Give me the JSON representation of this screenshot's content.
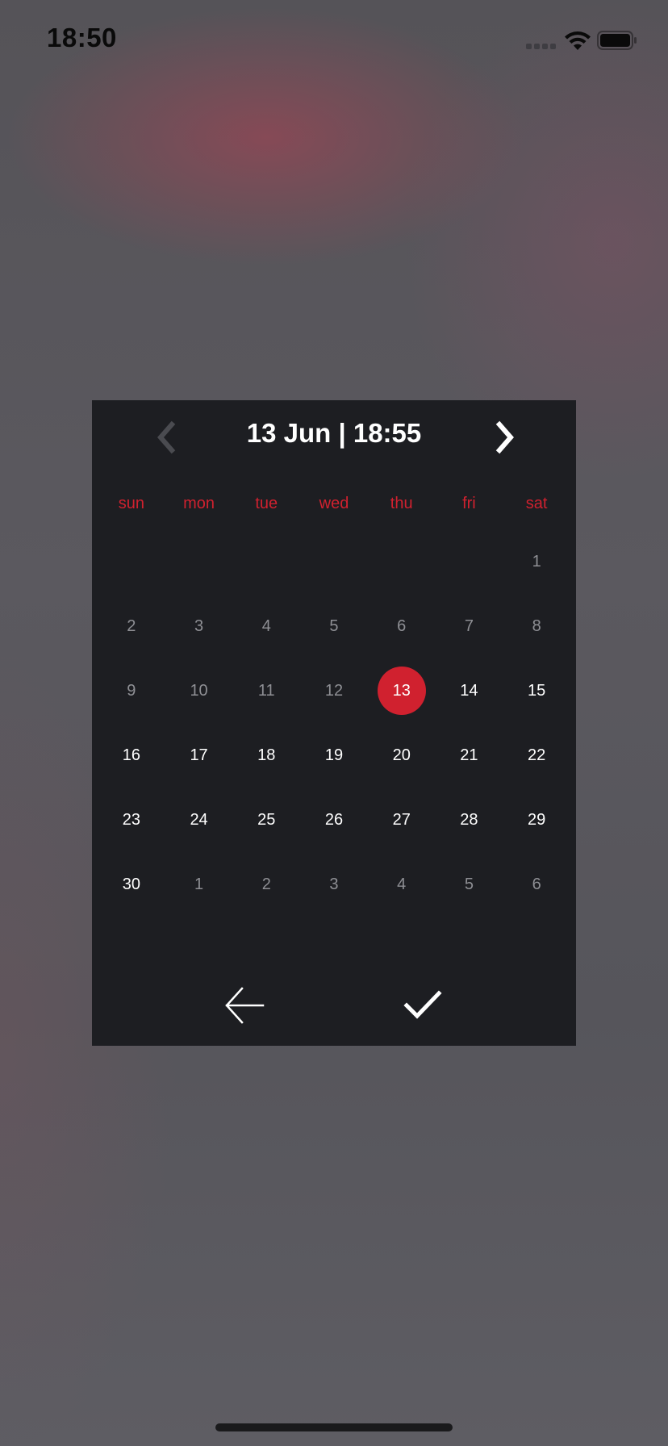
{
  "status_bar": {
    "time": "18:50"
  },
  "calendar": {
    "header_title": "13 Jun | 18:55",
    "weekdays": [
      "sun",
      "mon",
      "tue",
      "wed",
      "thu",
      "fri",
      "sat"
    ],
    "accent_color": "#d0212f",
    "selected_day": "13",
    "weeks": [
      [
        {
          "label": "",
          "state": "empty"
        },
        {
          "label": "",
          "state": "empty"
        },
        {
          "label": "",
          "state": "empty"
        },
        {
          "label": "",
          "state": "empty"
        },
        {
          "label": "",
          "state": "empty"
        },
        {
          "label": "",
          "state": "empty"
        },
        {
          "label": "1",
          "state": "muted"
        }
      ],
      [
        {
          "label": "2",
          "state": "muted"
        },
        {
          "label": "3",
          "state": "muted"
        },
        {
          "label": "4",
          "state": "muted"
        },
        {
          "label": "5",
          "state": "muted"
        },
        {
          "label": "6",
          "state": "muted"
        },
        {
          "label": "7",
          "state": "muted"
        },
        {
          "label": "8",
          "state": "muted"
        }
      ],
      [
        {
          "label": "9",
          "state": "muted"
        },
        {
          "label": "10",
          "state": "muted"
        },
        {
          "label": "11",
          "state": "muted"
        },
        {
          "label": "12",
          "state": "muted"
        },
        {
          "label": "13",
          "state": "selected"
        },
        {
          "label": "14",
          "state": "active"
        },
        {
          "label": "15",
          "state": "active"
        }
      ],
      [
        {
          "label": "16",
          "state": "active"
        },
        {
          "label": "17",
          "state": "active"
        },
        {
          "label": "18",
          "state": "active"
        },
        {
          "label": "19",
          "state": "active"
        },
        {
          "label": "20",
          "state": "active"
        },
        {
          "label": "21",
          "state": "active"
        },
        {
          "label": "22",
          "state": "active"
        }
      ],
      [
        {
          "label": "23",
          "state": "active"
        },
        {
          "label": "24",
          "state": "active"
        },
        {
          "label": "25",
          "state": "active"
        },
        {
          "label": "26",
          "state": "active"
        },
        {
          "label": "27",
          "state": "active"
        },
        {
          "label": "28",
          "state": "active"
        },
        {
          "label": "29",
          "state": "active"
        }
      ],
      [
        {
          "label": "30",
          "state": "active"
        },
        {
          "label": "1",
          "state": "muted"
        },
        {
          "label": "2",
          "state": "muted"
        },
        {
          "label": "3",
          "state": "muted"
        },
        {
          "label": "4",
          "state": "muted"
        },
        {
          "label": "5",
          "state": "muted"
        },
        {
          "label": "6",
          "state": "muted"
        }
      ]
    ],
    "icons": {
      "prev": "chevron-left-icon",
      "next": "chevron-right-icon",
      "back": "arrow-left-icon",
      "confirm": "checkmark-icon"
    }
  }
}
